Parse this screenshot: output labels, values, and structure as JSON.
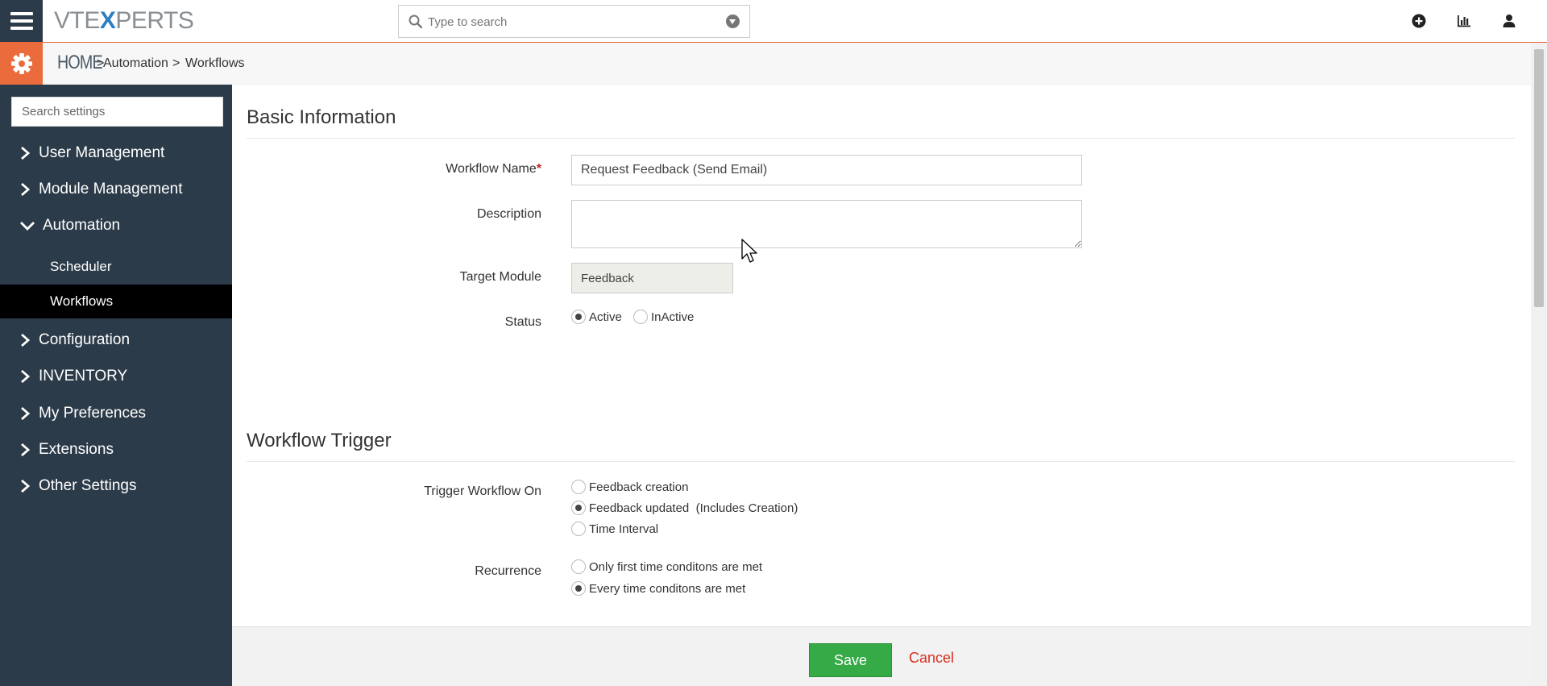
{
  "brand": {
    "logo_a": "VTE",
    "logo_x": "X",
    "logo_b": "PERTS"
  },
  "search": {
    "placeholder": "Type to search"
  },
  "breadcrumb": {
    "home": "HOME",
    "sep1": ">",
    "item1": "Automation",
    "sep2": ">",
    "item2": "Workflows"
  },
  "sidebar": {
    "search_placeholder": "Search settings",
    "items": [
      {
        "label": "User Management"
      },
      {
        "label": "Module Management"
      },
      {
        "label": "Automation"
      },
      {
        "label": "Configuration"
      },
      {
        "label": "INVENTORY"
      },
      {
        "label": "My Preferences"
      },
      {
        "label": "Extensions"
      },
      {
        "label": "Other Settings"
      }
    ],
    "automation_sub": [
      {
        "label": "Scheduler"
      },
      {
        "label": "Workflows"
      }
    ]
  },
  "basic_info": {
    "title": "Basic Information",
    "workflow_name_label": "Workflow Name",
    "required_mark": "*",
    "workflow_name_value": "Request Feedback (Send Email)",
    "description_label": "Description",
    "target_module_label": "Target Module",
    "target_module_value": "Feedback",
    "status_label": "Status",
    "status_active": "Active",
    "status_inactive": "InActive"
  },
  "trigger": {
    "title": "Workflow Trigger",
    "trigger_on_label": "Trigger Workflow On",
    "opt_creation": "Feedback creation",
    "opt_updated": "Feedback updated  (Includes Creation)",
    "opt_interval": "Time Interval",
    "recurrence_label": "Recurrence",
    "rec_first": "Only first time conditons are met",
    "rec_every": "Every time conditons are met"
  },
  "footer": {
    "save_label": "Save",
    "cancel_label": "Cancel"
  },
  "colors": {
    "sidebar_bg": "#2c3b49",
    "accent_orange": "#ea6b3c",
    "save_green": "#35aa47",
    "cancel_red": "#d82f1e",
    "logo_blue": "#2d7fc1"
  }
}
